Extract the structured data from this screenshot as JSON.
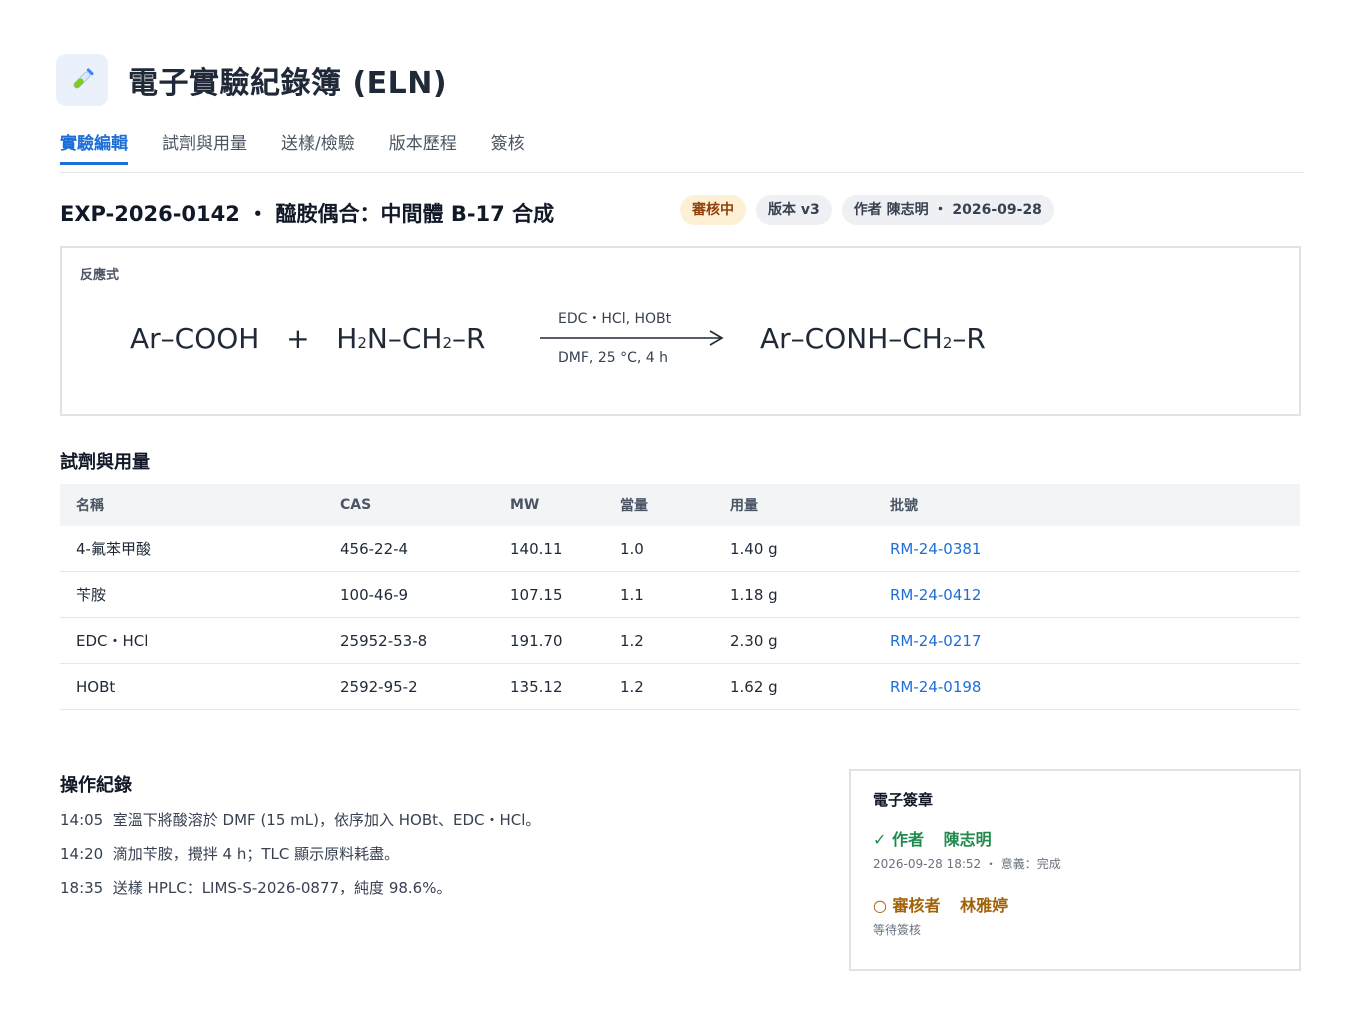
{
  "app": {
    "title": "電子實驗紀錄簿 (ELN)",
    "logo_icon": "test-tube-icon"
  },
  "tabs": [
    {
      "label": "實驗編輯",
      "active": true
    },
    {
      "label": "試劑與用量",
      "active": false
    },
    {
      "label": "送樣/檢驗",
      "active": false
    },
    {
      "label": "版本歷程",
      "active": false
    },
    {
      "label": "簽核",
      "active": false
    }
  ],
  "experiment": {
    "title": "EXP-2026-0142 ・ 醯胺偶合：中間體 B-17 合成",
    "status_badge": "審核中",
    "version_badge": "版本 v3",
    "author_badge": "作者 陳志明 ・ 2026-09-28"
  },
  "reaction": {
    "label": "反應式",
    "reactant_1": "Ar–COOH",
    "plus": "+",
    "reactant_2_a": "H",
    "reactant_2_sub1": "2",
    "reactant_2_b": "N–CH",
    "reactant_2_sub2": "2",
    "reactant_2_c": "–R",
    "conditions_top": "EDC・HCl, HOBt",
    "conditions_bottom": "DMF, 25 °C, 4 h",
    "product_a": "Ar–CONH–CH",
    "product_sub": "2",
    "product_b": "–R"
  },
  "reagents": {
    "title": "試劑與用量",
    "headers": [
      "名稱",
      "CAS",
      "MW",
      "當量",
      "用量",
      "批號"
    ],
    "rows": [
      {
        "name": "4-氟苯甲酸",
        "cas": "456-22-4",
        "mw": "140.11",
        "eq": "1.0",
        "amount": "1.40 g",
        "lot": "RM-24-0381"
      },
      {
        "name": "苄胺",
        "cas": "100-46-9",
        "mw": "107.15",
        "eq": "1.1",
        "amount": "1.18 g",
        "lot": "RM-24-0412"
      },
      {
        "name": "EDC・HCl",
        "cas": "25952-53-8",
        "mw": "191.70",
        "eq": "1.2",
        "amount": "2.30 g",
        "lot": "RM-24-0217"
      },
      {
        "name": "HOBt",
        "cas": "2592-95-2",
        "mw": "135.12",
        "eq": "1.2",
        "amount": "1.62 g",
        "lot": "RM-24-0198"
      }
    ]
  },
  "log": {
    "title": "操作紀錄",
    "entries": [
      {
        "time": "14:05",
        "text": "室溫下將酸溶於 DMF (15 mL)，依序加入 HOBt、EDC・HCl。"
      },
      {
        "time": "14:20",
        "text": "滴加苄胺，攪拌 4 h；TLC 顯示原料耗盡。"
      },
      {
        "time": "18:35",
        "text": "送樣 HPLC：LIMS-S-2026-0877，純度 98.6%。"
      }
    ]
  },
  "signature": {
    "title": "電子簽章",
    "author_mark": "✓",
    "author_role": "作者",
    "author_name": "陳志明",
    "author_meta": "2026-09-28 18:52 ・ 意義：完成",
    "reviewer_mark": "○",
    "reviewer_role": "審核者",
    "reviewer_name": "林雅婷",
    "reviewer_meta": "等待簽核"
  },
  "colors": {
    "accent": "#1d6fd8",
    "signed": "#1f8a4c",
    "pending": "#a16207",
    "status_badge_bg": "#fdf0d5"
  }
}
